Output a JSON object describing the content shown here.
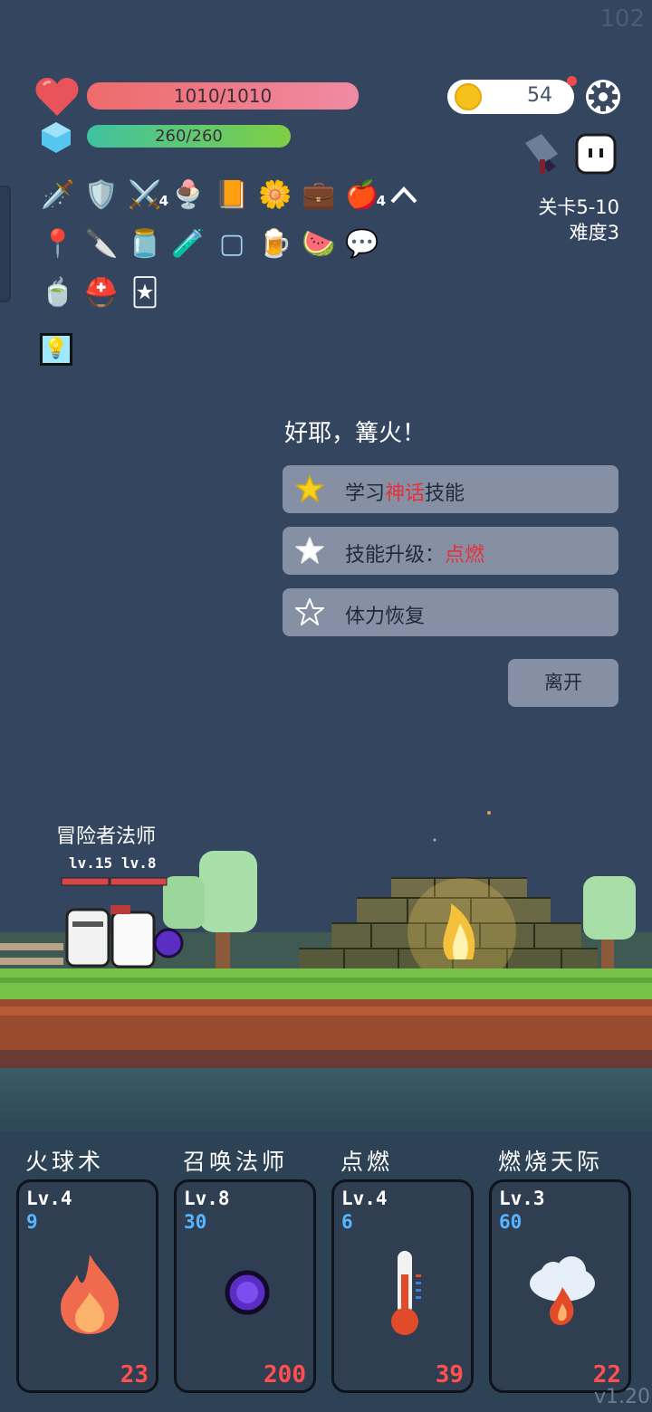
{
  "fps": "102",
  "stats": {
    "hp": "1010/1010",
    "mp": "260/260"
  },
  "coins": "54",
  "stage": {
    "level": "关卡5-10",
    "difficulty": "难度3"
  },
  "inventory": {
    "row1": [
      {
        "icon": "dagger-icon",
        "glyph": "🗡️"
      },
      {
        "icon": "shield-icon",
        "glyph": "🛡️"
      },
      {
        "icon": "sword-icon",
        "glyph": "⚔️",
        "count": "4"
      },
      {
        "icon": "ice-cream-icon",
        "glyph": "🍨"
      },
      {
        "icon": "book-icon",
        "glyph": "📙"
      },
      {
        "icon": "flower-icon",
        "glyph": "🌼"
      },
      {
        "icon": "briefcase-icon",
        "glyph": "💼"
      },
      {
        "icon": "apple-icon",
        "glyph": "🍎",
        "count": "4"
      }
    ],
    "row2": [
      {
        "icon": "map-pin-icon",
        "glyph": "📍"
      },
      {
        "icon": "blade-icon",
        "glyph": "🔪"
      },
      {
        "icon": "jam-jar-icon",
        "glyph": "🫙"
      },
      {
        "icon": "potion-icon",
        "glyph": "🧪"
      },
      {
        "icon": "frame-icon",
        "glyph": "▢"
      },
      {
        "icon": "beer-icon",
        "glyph": "🍺"
      },
      {
        "icon": "watermelon-icon",
        "glyph": "🍉"
      },
      {
        "icon": "chat-bubble-icon",
        "glyph": "💬"
      }
    ],
    "row3": [
      {
        "icon": "tea-cup-icon",
        "glyph": "🍵"
      },
      {
        "icon": "viking-helmet-icon",
        "glyph": "⛑️"
      },
      {
        "icon": "playing-cards-icon",
        "glyph": "🃏"
      }
    ],
    "active": {
      "icon": "lightbulb-icon",
      "glyph": "💡"
    }
  },
  "dialog": {
    "title": "好耶，篝火！",
    "options": [
      {
        "pre": "学习",
        "hl": "神话",
        "post": "技能"
      },
      {
        "pre": "技能升级：",
        "hl": "点燃",
        "post": ""
      },
      {
        "pre": "体力恢复",
        "hl": "",
        "post": ""
      }
    ],
    "leave": "离开"
  },
  "party": {
    "names": "冒险者法师",
    "lv1": "lv.15",
    "lv2": "lv.8"
  },
  "skills": [
    {
      "name": "火球术",
      "level": "Lv.4",
      "mana": "9",
      "cost": "23",
      "icon": "fire-icon"
    },
    {
      "name": "召唤法师",
      "level": "Lv.8",
      "mana": "30",
      "cost": "200",
      "icon": "purple-orb-icon"
    },
    {
      "name": "点燃",
      "level": "Lv.4",
      "mana": "6",
      "cost": "39",
      "icon": "thermometer-icon"
    },
    {
      "name": "燃烧天际",
      "level": "Lv.3",
      "mana": "60",
      "cost": "22",
      "icon": "fire-cloud-icon"
    }
  ],
  "version": "v1.20",
  "colors": {
    "background": "#34465f",
    "option": "#8590a4",
    "highlight": "#e8303a",
    "cost": "#ff5050",
    "mana": "#55b7ff"
  }
}
